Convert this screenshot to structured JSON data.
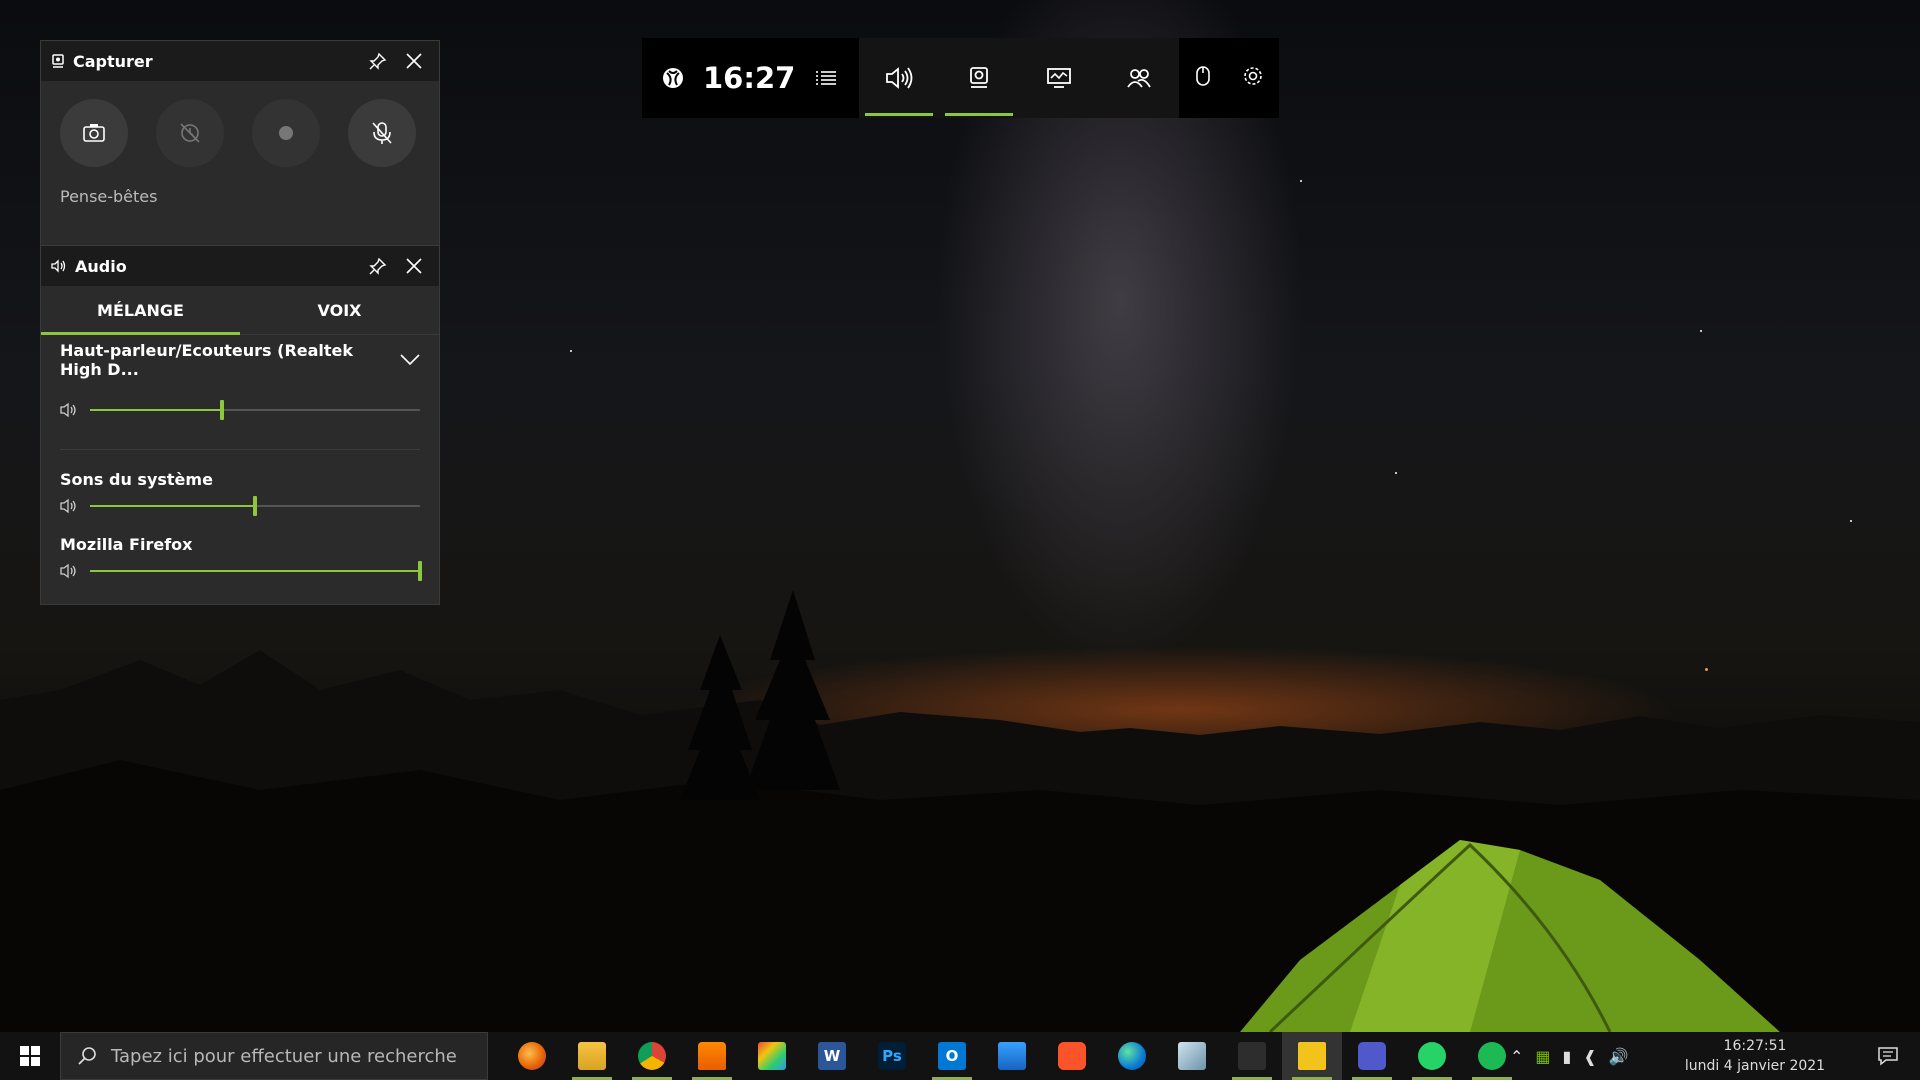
{
  "gamebar": {
    "clock": "16:27",
    "icons": [
      "xbox-icon",
      "widget-menu-icon",
      "audio-icon",
      "capture-icon",
      "performance-icon",
      "social-icon",
      "mouse-icon",
      "settings-icon"
    ],
    "accent": "#8dc63f"
  },
  "capture": {
    "title": "Capturer",
    "note_label": "Pense-bêtes",
    "buttons": [
      "screenshot",
      "record-last",
      "record",
      "microphone-off"
    ]
  },
  "audio": {
    "title": "Audio",
    "tabs": [
      {
        "label": "MÉLANGE",
        "active": true
      },
      {
        "label": "VOIX",
        "active": false
      }
    ],
    "device": "Haut-parleur/Ecouteurs (Realtek High D...",
    "device_volume": 0.4,
    "apps": [
      {
        "name": "Sons du système",
        "volume": 0.5
      },
      {
        "name": "Mozilla Firefox",
        "volume": 1.0
      }
    ]
  },
  "taskbar": {
    "search_placeholder": "Tapez ici pour effectuer une recherche",
    "time": "16:27:51",
    "date": "lundi 4 janvier 2021",
    "apps": [
      {
        "name": "firefox",
        "label": "",
        "running": false
      },
      {
        "name": "file-explorer",
        "label": "",
        "running": true
      },
      {
        "name": "chrome",
        "label": "",
        "running": true
      },
      {
        "name": "vlc",
        "label": "",
        "running": true
      },
      {
        "name": "color-app",
        "label": "",
        "running": false
      },
      {
        "name": "word",
        "label": "W",
        "running": false
      },
      {
        "name": "photoshop",
        "label": "Ps",
        "running": false
      },
      {
        "name": "outlook",
        "label": "O",
        "running": true
      },
      {
        "name": "phone-app",
        "label": "",
        "running": false
      },
      {
        "name": "brave",
        "label": "",
        "running": false
      },
      {
        "name": "edge",
        "label": "",
        "running": false
      },
      {
        "name": "files-app",
        "label": "",
        "running": false
      },
      {
        "name": "equalizer-app",
        "label": "",
        "running": true
      },
      {
        "name": "sticky-notes",
        "label": "",
        "running": true
      },
      {
        "name": "teams",
        "label": "",
        "running": true
      },
      {
        "name": "whatsapp",
        "label": "",
        "running": true
      },
      {
        "name": "spotify",
        "label": "",
        "running": true
      }
    ]
  }
}
